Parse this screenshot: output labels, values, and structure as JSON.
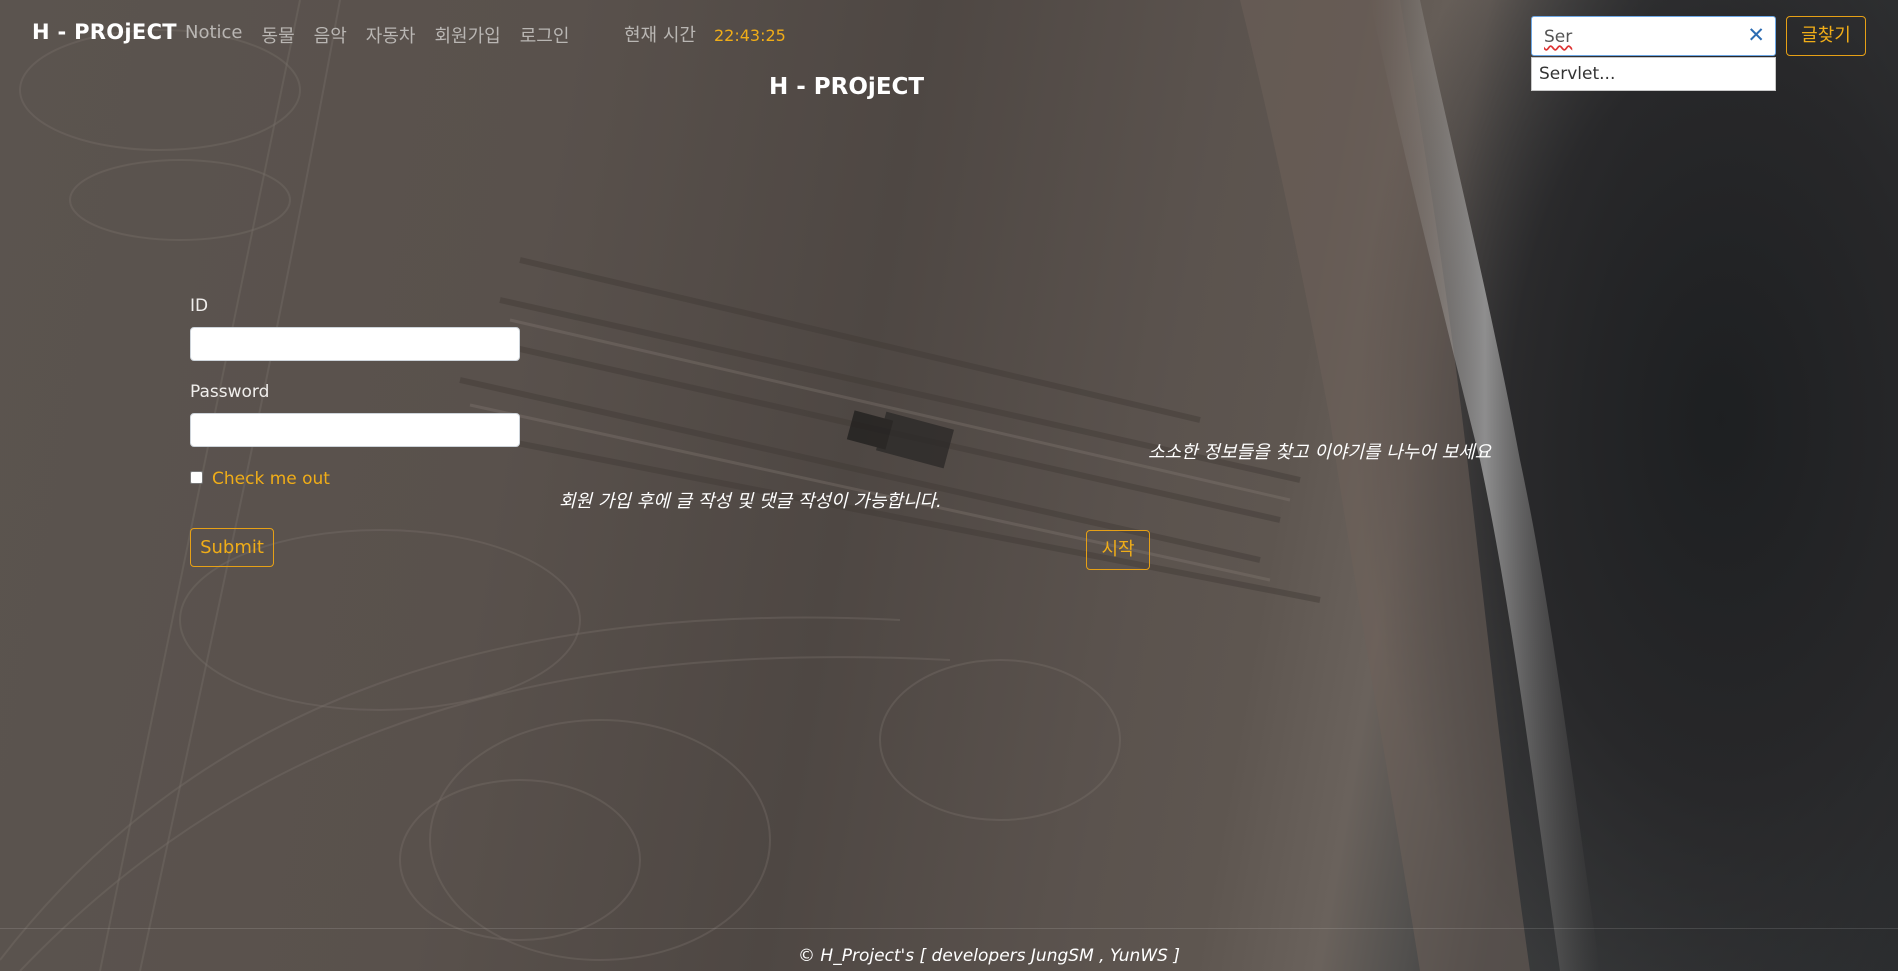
{
  "navbar": {
    "brand": "H - PROjECT",
    "items": [
      {
        "label": "Notice"
      },
      {
        "label": "동물"
      },
      {
        "label": "음악"
      },
      {
        "label": "자동차"
      },
      {
        "label": "회원가입"
      },
      {
        "label": "로그인"
      }
    ],
    "clock_label": "현재 시간",
    "clock_time": "22:43:25"
  },
  "search": {
    "value": "Ser",
    "suggestion": "Servlet...",
    "button_label": "글찾기"
  },
  "page_title": "H - PROjECT",
  "login_form": {
    "id_label": "ID",
    "id_value": "",
    "password_label": "Password",
    "password_value": "",
    "checkbox_label": "Check me out",
    "checkbox_checked": false,
    "submit_label": "Submit"
  },
  "hero": {
    "line1": "소소한 정보들을 찾고 이야기를 나누어 보세요",
    "line2": "회원 가입 후에 글 작성 및 댓글 작성이 가능합니다.",
    "start_label": "시작"
  },
  "footer": {
    "text": "© H_Project's [ developers JungSM , YunWS ]"
  },
  "colors": {
    "accent": "#f0ad18",
    "nav_text": "#b9b6b3",
    "sand": "#5b534e",
    "ocean": "#2b2d2f"
  }
}
